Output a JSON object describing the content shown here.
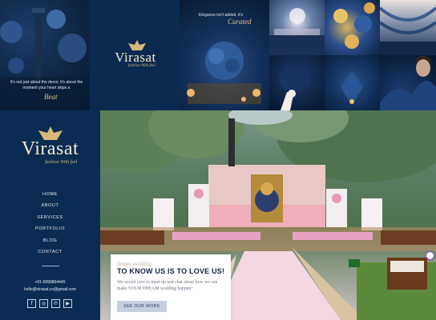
{
  "gallery": {
    "quote_1": "It's not just about the decor, it's about the moment your heart skips a",
    "quote_1_sign": "Beat",
    "brand": "Virasat",
    "brand_tagline": "fashion With feel",
    "quote_2": "Elegance isn't added, it's",
    "quote_2_sign": "Curated"
  },
  "sidebar": {
    "brand": "Virasat",
    "tagline": "fashion With feel",
    "nav": [
      "HOME",
      "ABOUT",
      "SERVICES",
      "PORTFOLIO",
      "BLOG",
      "CONTACT"
    ],
    "phone": "+91-9999864445",
    "email": "hello@virasat.co@gmail.com",
    "socials": [
      "facebook-icon",
      "instagram-icon",
      "pinterest-icon",
      "youtube-icon"
    ]
  },
  "welcome": {
    "kicker": "dream wedding",
    "title": "TO KNOW US IS TO LOVE US!",
    "body": "We would love to meet up and chat about how we can make YOUR DREAM wedding happen!",
    "button": "SEE OUR WORK"
  },
  "colors": {
    "navy": "#0b2c52",
    "gold": "#d6b87a",
    "card": "#ffffff",
    "button": "#c5cfe0"
  }
}
